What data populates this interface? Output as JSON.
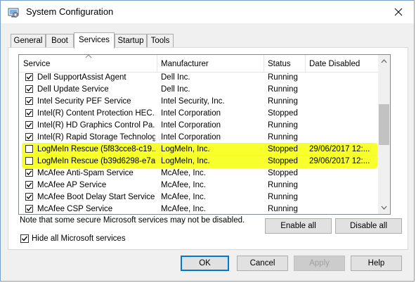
{
  "window": {
    "title": "System Configuration",
    "close_icon": "close-icon",
    "app_icon": "system-config-icon"
  },
  "tabs": [
    {
      "label": "General",
      "active": false
    },
    {
      "label": "Boot",
      "active": false
    },
    {
      "label": "Services",
      "active": true
    },
    {
      "label": "Startup",
      "active": false
    },
    {
      "label": "Tools",
      "active": false
    }
  ],
  "list": {
    "columns": [
      "Service",
      "Manufacturer",
      "Status",
      "Date Disabled"
    ],
    "rows": [
      {
        "checked": true,
        "service": "Dell SupportAssist Agent",
        "manufacturer": "Dell Inc.",
        "status": "Running",
        "date": ""
      },
      {
        "checked": true,
        "service": "Dell Update Service",
        "manufacturer": "Dell Inc.",
        "status": "Running",
        "date": ""
      },
      {
        "checked": true,
        "service": "Intel Security PEF Service",
        "manufacturer": "Intel Security, Inc.",
        "status": "Running",
        "date": ""
      },
      {
        "checked": true,
        "service": "Intel(R) Content Protection HEC...",
        "manufacturer": "Intel Corporation",
        "status": "Stopped",
        "date": ""
      },
      {
        "checked": true,
        "service": "Intel(R) HD Graphics Control Pa...",
        "manufacturer": "Intel Corporation",
        "status": "Running",
        "date": ""
      },
      {
        "checked": true,
        "service": "Intel(R) Rapid Storage Technology",
        "manufacturer": "Intel Corporation",
        "status": "Running",
        "date": ""
      },
      {
        "checked": false,
        "service": "LogMeIn Rescue (5f83cce8-c19...",
        "manufacturer": "LogMeIn, Inc.",
        "status": "Stopped",
        "date": "29/06/2017 12:...",
        "highlight": true
      },
      {
        "checked": false,
        "service": "LogMeIn Rescue (b39d6298-e7a...",
        "manufacturer": "LogMeIn, Inc.",
        "status": "Stopped",
        "date": "29/06/2017 12:...",
        "highlight": true
      },
      {
        "checked": true,
        "service": "McAfee Anti-Spam Service",
        "manufacturer": "McAfee, Inc.",
        "status": "Stopped",
        "date": ""
      },
      {
        "checked": true,
        "service": "McAfee AP Service",
        "manufacturer": "McAfee, Inc.",
        "status": "Running",
        "date": ""
      },
      {
        "checked": true,
        "service": "McAfee Boot Delay Start Service",
        "manufacturer": "McAfee, Inc.",
        "status": "Running",
        "date": ""
      },
      {
        "checked": true,
        "service": "McAfee CSP Service",
        "manufacturer": "McAfee, Inc.",
        "status": "Running",
        "date": ""
      }
    ],
    "highlight_color": "#f7ff21"
  },
  "note": "Note that some secure Microsoft services may not be disabled.",
  "enable_all_label": "Enable all",
  "disable_all_label": "Disable all",
  "hide_ms_label": "Hide all Microsoft services",
  "hide_ms_checked": true,
  "ok_label": "OK",
  "cancel_label": "Cancel",
  "apply_label": "Apply",
  "help_label": "Help"
}
